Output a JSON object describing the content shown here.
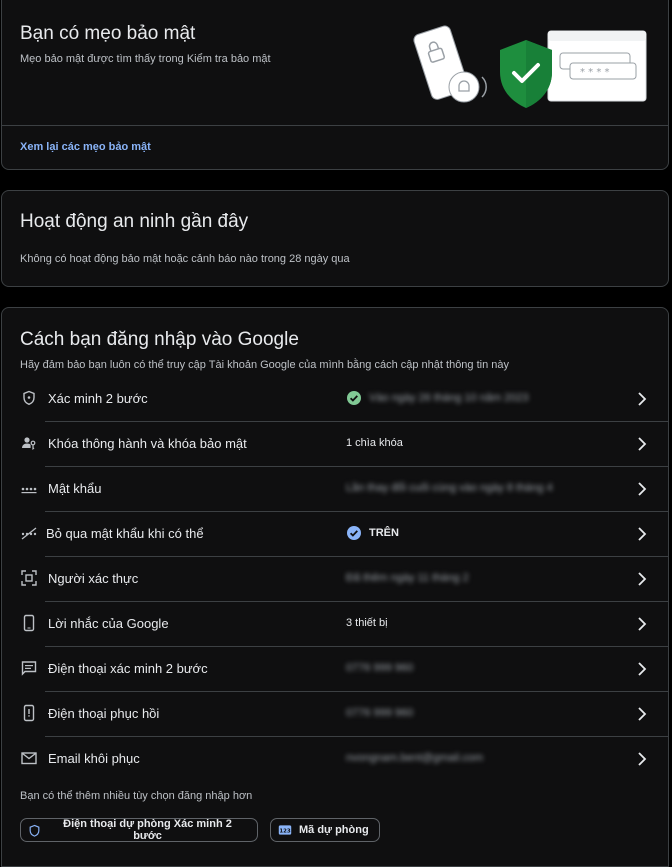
{
  "tips": {
    "title": "Bạn có mẹo bảo mật",
    "subtitle": "Mẹo bảo mật được tìm thấy trong Kiểm tra bảo mật",
    "link": "Xem lại các mẹo bảo mật"
  },
  "activity": {
    "title": "Hoạt động an ninh gần đây",
    "subtitle": "Không có hoạt động bảo mật hoặc cảnh báo nào trong 28 ngày qua"
  },
  "signin": {
    "title": "Cách bạn đăng nhập vào Google",
    "subtitle": "Hãy đảm bảo bạn luôn có thể truy cập Tài khoản Google của mình bằng cách cập nhật thông tin này",
    "rows": [
      {
        "label": "Xác minh 2 bước",
        "value": "Vào ngày 26 tháng 10 năm 2023",
        "icon": "shield-icon",
        "status": "check-circle-icon"
      },
      {
        "label": "Khóa thông hành và khóa bảo mật",
        "value": "1 chìa khóa",
        "icon": "passkey-icon"
      },
      {
        "label": "Mật khẩu",
        "value": "Lần thay đổi cuối cùng vào ngày 8 tháng 4",
        "icon": "password-dots-icon"
      },
      {
        "label": "Bỏ qua mật khẩu khi có thể",
        "value": "TRÊN",
        "icon": "skip-password-icon",
        "status": "verified-badge-icon"
      },
      {
        "label": "Người xác thực",
        "value": "Đã thêm ngày 11 tháng 2",
        "icon": "authenticator-icon"
      },
      {
        "label": "Lời nhắc của Google",
        "value": "3 thiết bị",
        "icon": "phone-icon"
      },
      {
        "label": "Điện thoại xác minh 2 bước",
        "value": "0776 999 960",
        "icon": "sms-icon"
      },
      {
        "label": "Điện thoại phục hồi",
        "value": "0776 999 960",
        "icon": "recovery-phone-icon"
      },
      {
        "label": "Email khôi phục",
        "value": "nvongnam.bent@gmail.com",
        "icon": "mail-icon"
      }
    ],
    "more_text": "Bạn có thể thêm nhiều tùy chọn đăng nhập hơn",
    "chips": {
      "backup_phone": "Điện thoại dự phòng Xác minh 2 bước",
      "backup_codes": "Mã dự phòng"
    }
  },
  "colors": {
    "accent_blue": "#8ab4f8",
    "success_green": "#81c995",
    "shield_green": "#1e8e3e"
  }
}
